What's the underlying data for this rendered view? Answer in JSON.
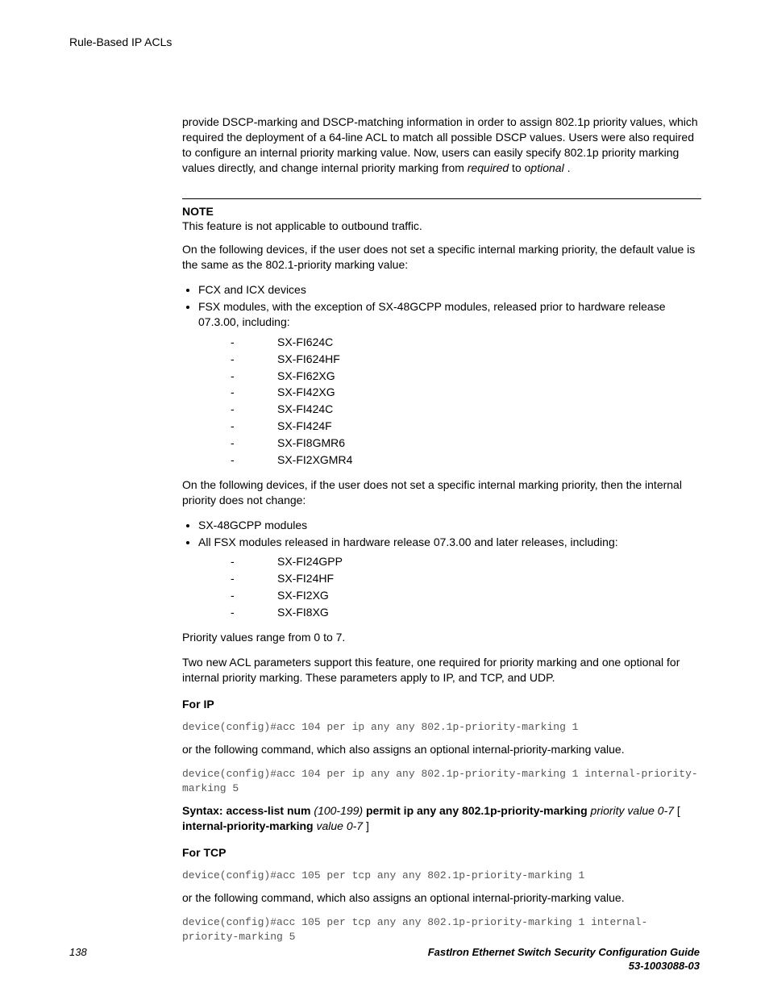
{
  "header": {
    "running_title": "Rule-Based IP ACLs"
  },
  "body": {
    "intro_para": "provide DSCP-marking and DSCP-matching information in order to assign 802.1p priority values, which required the deployment of a 64-line ACL to match all possible DSCP values. Users were also required to configure an internal priority marking value. Now, users can easily specify 802.1p priority marking values directly, and change internal priority marking from ",
    "intro_em1": "required",
    "intro_mid": " to o",
    "intro_em2": "ptional",
    "intro_end": " .",
    "note_label": "NOTE",
    "note_text": "This feature is not applicable to outbound traffic.",
    "para_devices_default": "On the following devices, if the user does not set a specific internal marking priority, the default value is the same as the 802.1-priority marking value:",
    "bullets1": {
      "item1": "FCX and ICX devices",
      "item2": "FSX modules, with the exception of SX-48GCPP modules, released prior to hardware release 07.3.00, including:"
    },
    "dash_list1": [
      "SX-FI624C",
      "SX-FI624HF",
      "SX-FI62XG",
      "SX-FI42XG",
      "SX-FI424C",
      "SX-FI424F",
      "SX-FI8GMR6",
      "SX-FI2XGMR4"
    ],
    "para_devices_nochange": "On the following devices, if the user does not set a specific internal marking priority, then the internal priority does not change:",
    "bullets2": {
      "item1": "SX-48GCPP modules",
      "item2": "All FSX modules released in hardware release 07.3.00 and later releases, including:"
    },
    "dash_list2": [
      "SX-FI24GPP",
      "SX-FI24HF",
      "SX-FI2XG",
      "SX-FI8XG"
    ],
    "para_priority_range": "Priority values range from 0 to 7.",
    "para_two_new": "Two new ACL parameters support this feature, one required for priority marking and one optional for internal priority marking. These parameters apply to IP, and TCP, and UDP.",
    "for_ip_heading": "For IP",
    "code_ip_1": "device(config)#acc 104 per ip any any 802.1p-priority-marking 1",
    "para_or_follow": "or the following command, which also assigns an optional internal-priority-marking value.",
    "code_ip_2": "device(config)#acc 104 per ip any any 802.1p-priority-marking 1 internal-priority-marking 5",
    "syntax_ip": {
      "s1": "Syntax: access-list num ",
      "i1": "(100-199)",
      "s2": " permit ip any any 802.1p-priority-marking ",
      "i2": "priority value 0-7",
      "s3": " [ ",
      "s4": "internal-priority-marking ",
      "i3": "value 0-7",
      "s5": " ]"
    },
    "for_tcp_heading": "For TCP",
    "code_tcp_1": "device(config)#acc 105 per tcp any any 802.1p-priority-marking 1",
    "code_tcp_2": "device(config)#acc 105 per tcp any any 802.1p-priority-marking 1 internal-priority-marking 5"
  },
  "footer": {
    "page_number": "138",
    "doc_title": "FastIron Ethernet Switch Security Configuration Guide",
    "doc_id": "53-1003088-03"
  }
}
